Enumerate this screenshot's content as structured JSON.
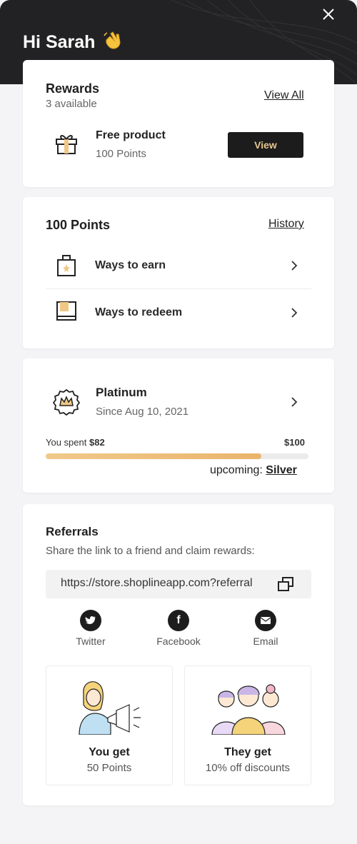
{
  "header": {
    "greeting": "Hi Sarah",
    "wave_icon": "waving-hand-icon",
    "close_icon": "close-icon"
  },
  "rewards": {
    "title": "Rewards",
    "available": "3 available",
    "view_all": "View All",
    "item": {
      "name": "Free product",
      "points": "100 Points",
      "button": "View",
      "icon": "gift-icon"
    }
  },
  "points": {
    "title": "100 Points",
    "history": "History",
    "rows": [
      {
        "label": "Ways to earn",
        "icon": "earn-box-icon"
      },
      {
        "label": "Ways to redeem",
        "icon": "redeem-book-icon"
      }
    ]
  },
  "tier": {
    "name": "Platinum",
    "since": "Since Aug 10, 2021",
    "spent_label": "You spent",
    "spent_value": "$82",
    "target": "$100",
    "progress": 0.82,
    "upcoming_label": "upcoming:",
    "upcoming_tier": "Silver",
    "icon": "crown-badge-icon"
  },
  "referrals": {
    "title": "Referrals",
    "description": "Share the link to a friend and claim rewards:",
    "url": "https://store.shoplineapp.com?referral",
    "share": [
      {
        "label": "Twitter",
        "icon": "twitter-icon"
      },
      {
        "label": "Facebook",
        "icon": "facebook-icon"
      },
      {
        "label": "Email",
        "icon": "email-icon"
      }
    ],
    "you_get": {
      "title": "You get",
      "value": "50 Points"
    },
    "they_get": {
      "title": "They get",
      "value": "10% off discounts"
    }
  },
  "colors": {
    "accent": "#e9b46c",
    "dark": "#1c1c1c",
    "button_text": "#e8c58f"
  }
}
